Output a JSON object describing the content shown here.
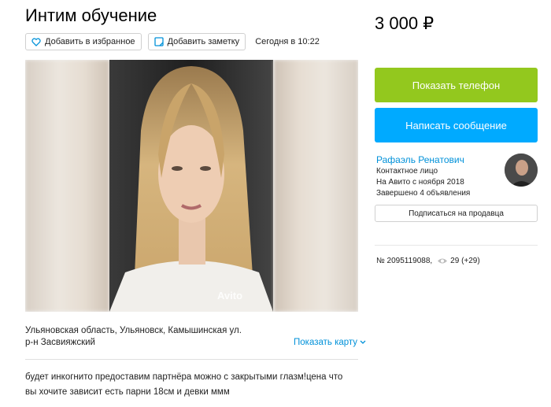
{
  "listing": {
    "title": "Интим обучение",
    "price": "3 000 ₽",
    "add_favorite_label": "Добавить в избранное",
    "add_note_label": "Добавить заметку",
    "date": "Сегодня в 10:22",
    "photo_watermark": "Avito",
    "address": "Ульяновская область, Ульяновск, Камышинская ул.",
    "district": "р-н Засвияжский",
    "show_map_label": "Показать карту",
    "description": "будет инкогнито предоставим партнёра можно с закрытыми глазм!цена что вы хочите зависит есть парни 18см и девки ммм"
  },
  "sidebar": {
    "show_phone_label": "Показать телефон",
    "write_message_label": "Написать сообщение",
    "seller_name": "Рафаэль Ренатович",
    "seller_role": "Контактное лицо",
    "seller_since": "На Авито с ноября 2018",
    "seller_completed": "Завершено 4 объявления",
    "subscribe_label": "Подписаться на продавца",
    "listing_number": "№ 2095119088,",
    "views": "29 (+29)"
  },
  "colors": {
    "green": "#93c81e",
    "blue": "#00aaff",
    "link": "#0091d9"
  },
  "icons": [
    "heart-icon",
    "note-icon",
    "eye-icon",
    "chevron-down-icon"
  ]
}
